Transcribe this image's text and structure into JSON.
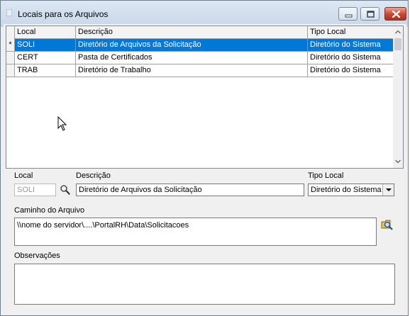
{
  "window": {
    "title": "Locais para os Arquivos"
  },
  "grid": {
    "columns": [
      "Local",
      "Descrição",
      "Tipo Local"
    ],
    "rows": [
      {
        "indicator": "*",
        "local": "SOLI",
        "descricao": "Diretório de Arquivos da Solicitação",
        "tipo": "Diretório do Sistema"
      },
      {
        "indicator": "",
        "local": "CERT",
        "descricao": "Pasta de Certificados",
        "tipo": "Diretório do Sistema"
      },
      {
        "indicator": "",
        "local": "TRAB",
        "descricao": "Diretório de Trabalho",
        "tipo": "Diretório do Sistema"
      }
    ]
  },
  "form": {
    "local_label": "Local",
    "local_value": "SOLI",
    "descricao_label": "Descrição",
    "descricao_value": "Diretório de Arquivos da Solicitação",
    "tipo_label": "Tipo Local",
    "tipo_value": "Diretório do Sistema",
    "caminho_label": "Caminho do Arquivo",
    "caminho_value": "\\\\nome do servidor\\....\\PortalRH\\Data\\Solicitacoes",
    "obs_label": "Observações",
    "obs_value": ""
  },
  "icons": {
    "lookup": "magnifier-lookup-icon",
    "browse": "folder-search-icon",
    "minimize": "minimize-icon",
    "maximize": "maximize-icon",
    "close": "close-icon"
  },
  "colors": {
    "selection": "#0078d7",
    "close_button": "#c44631"
  }
}
